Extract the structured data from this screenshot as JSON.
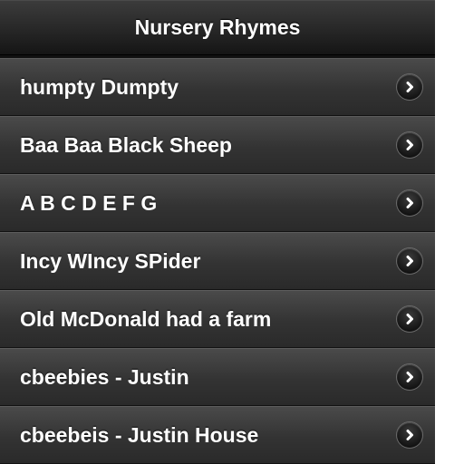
{
  "header": {
    "title": "Nursery Rhymes"
  },
  "list": {
    "items": [
      {
        "label": "humpty Dumpty",
        "icon": "chevron-right-icon"
      },
      {
        "label": "Baa Baa Black Sheep",
        "icon": "chevron-right-icon"
      },
      {
        "label": "A B C D E F G",
        "icon": "chevron-right-icon"
      },
      {
        "label": "Incy WIncy SPider",
        "icon": "chevron-right-icon"
      },
      {
        "label": "Old McDonald had a farm",
        "icon": "chevron-right-icon"
      },
      {
        "label": "cbeebies - Justin",
        "icon": "chevron-right-icon"
      },
      {
        "label": "cbeebeis - Justin House",
        "icon": "chevron-right-icon"
      }
    ]
  },
  "colors": {
    "header_background": "#222222",
    "list_background": "#333333",
    "text": "#ffffff",
    "arrow_background": "#1a1a1a"
  }
}
